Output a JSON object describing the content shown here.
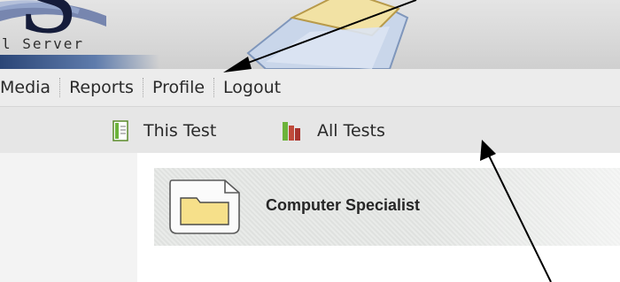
{
  "header": {
    "logo_text": "l Server",
    "logo_letter": "S"
  },
  "nav": {
    "items": [
      {
        "label": "Media"
      },
      {
        "label": "Reports"
      },
      {
        "label": "Profile"
      },
      {
        "label": "Logout"
      }
    ]
  },
  "subnav": {
    "items": [
      {
        "label": "This Test",
        "icon": "document-icon"
      },
      {
        "label": "All Tests",
        "icon": "books-icon"
      }
    ]
  },
  "content": {
    "panel_title": "Computer Specialist",
    "panel_icon": "folder-icon"
  },
  "colors": {
    "arrow": "#000000",
    "nav_bg": "#ececec",
    "subnav_bg": "#e6e6e6",
    "logo_blue": "#2b4677"
  }
}
